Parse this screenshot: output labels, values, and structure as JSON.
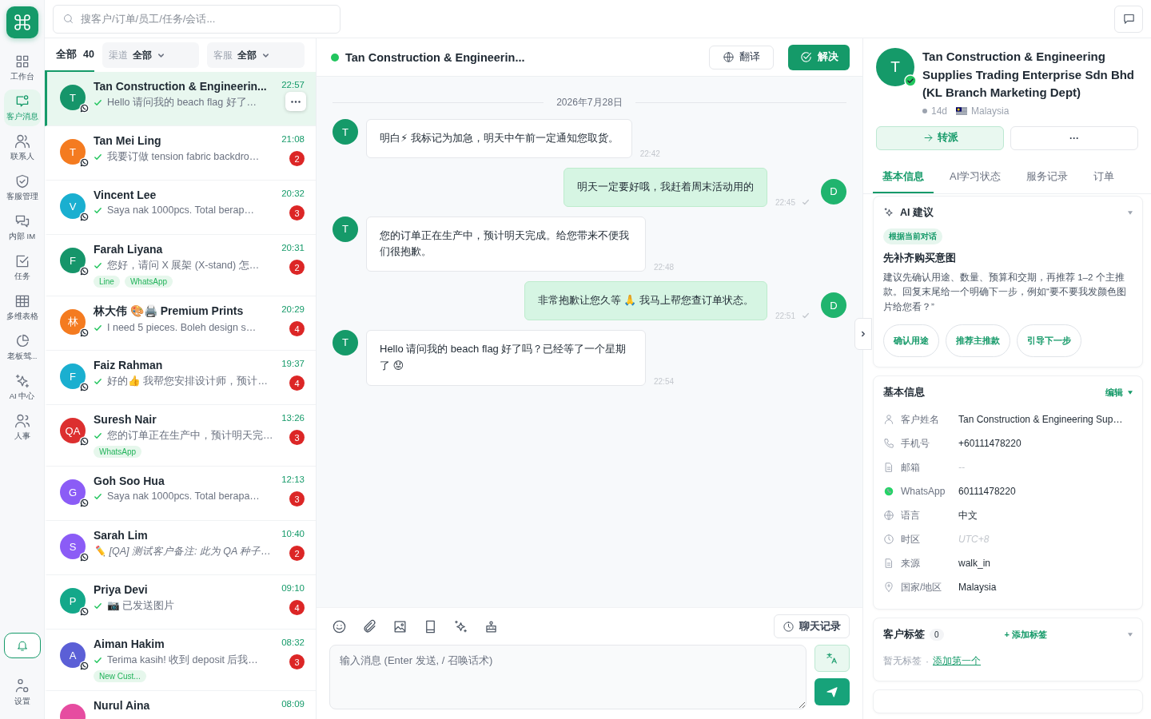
{
  "nav": {
    "items": [
      {
        "label": "工作台",
        "selected": false
      },
      {
        "label": "客户消息",
        "selected": true
      },
      {
        "label": "联系人",
        "selected": false
      },
      {
        "label": "客服管理",
        "selected": false
      },
      {
        "label": "内部 IM",
        "selected": false
      },
      {
        "label": "任务",
        "selected": false
      },
      {
        "label": "多维表格",
        "selected": false
      },
      {
        "label": "老板驾...",
        "selected": false
      },
      {
        "label": "AI 中心",
        "selected": false
      },
      {
        "label": "人事",
        "selected": false
      }
    ],
    "settings_label": "设置"
  },
  "search": {
    "placeholder": "搜客户/订单/员工/任务/会话..."
  },
  "conversation_list": {
    "tab": {
      "label": "全部",
      "count": "40",
      "selected": true
    },
    "filters": [
      {
        "label": "渠道",
        "value": "全部"
      },
      {
        "label": "客服",
        "value": "全部"
      }
    ],
    "items": [
      {
        "name": "Tan Construction & Engineerin...",
        "avatar": "T",
        "color": "#16956a",
        "time": "22:57",
        "kind": "message",
        "preview": "Hello 请问我的 beach flag 好了…",
        "selected": true,
        "hovered": true
      },
      {
        "name": "Tan Mei Ling",
        "avatar": "T",
        "color": "#f47b20",
        "time": "21:08",
        "kind": "message",
        "preview": "我要订做 tension fabric backdro…",
        "unread": "2",
        "selected": false,
        "hovered": false
      },
      {
        "name": "Vincent Lee",
        "avatar": "V",
        "color": "#1aafd0",
        "time": "20:32",
        "kind": "message",
        "preview": "Saya nak 1000pcs. Total berap…",
        "unread": "3",
        "selected": false,
        "hovered": false
      },
      {
        "name": "Farah Liyana",
        "avatar": "F",
        "color": "#16956a",
        "time": "20:31",
        "kind": "message",
        "preview": "您好，请问 X 展架 (X-stand) 怎…",
        "unread": "2",
        "tags": [
          "Line",
          "WhatsApp"
        ],
        "selected": false,
        "hovered": false
      },
      {
        "name": "林大伟 🎨🖨️ Premium Prints",
        "avatar": "林",
        "color": "#f47b20",
        "time": "20:29",
        "kind": "message",
        "preview": "I need 5 pieces. Boleh design s…",
        "unread": "4",
        "selected": false,
        "hovered": false
      },
      {
        "name": "Faiz Rahman",
        "avatar": "F",
        "color": "#1aafd0",
        "time": "19:37",
        "kind": "message",
        "preview": "好的👍 我帮您安排设计师，预计…",
        "unread": "4",
        "selected": false,
        "hovered": false
      },
      {
        "name": "Suresh Nair",
        "avatar": "QA",
        "color": "#dc2f2f",
        "time": "13:26",
        "kind": "message",
        "preview": "您的订单正在生产中，预计明天完…",
        "unread": "3",
        "tags": [
          "WhatsApp"
        ],
        "selected": false,
        "hovered": false
      },
      {
        "name": "Goh Soo Hua",
        "avatar": "G",
        "color": "#8b5cf6",
        "time": "12:13",
        "kind": "message",
        "preview": "Saya nak 1000pcs. Total berapa…",
        "unread": "3",
        "selected": false,
        "hovered": false
      },
      {
        "name": "Sarah Lim",
        "avatar": "S",
        "color": "#8b5cf6",
        "time": "10:40",
        "kind": "note",
        "preview": "✏️ [QA] 测试客户备注: 此为 QA 种子…",
        "unread": "2",
        "selected": false,
        "hovered": false
      },
      {
        "name": "Priya Devi",
        "avatar": "P",
        "color": "#14a88a",
        "time": "09:10",
        "kind": "message",
        "preview": "📷 已发送图片",
        "unread": "4",
        "selected": false,
        "hovered": false
      },
      {
        "name": "Aiman Hakim",
        "avatar": "A",
        "color": "#5b5fd6",
        "time": "08:32",
        "kind": "message",
        "preview": "Terima kasih! 收到 deposit 后我…",
        "unread": "3",
        "tags": [
          "New Cust..."
        ],
        "selected": false,
        "hovered": false
      },
      {
        "name": "Nurul Aina",
        "color": "#e64ca0",
        "time": "08:09",
        "selected": false,
        "hovered": false
      }
    ]
  },
  "chat": {
    "title": "Tan Construction & Engineerin...",
    "online": true,
    "buttons": {
      "translate": "翻译",
      "resolve": "解决"
    },
    "date": "2026年7月28日",
    "messages": [
      {
        "kind": "incoming",
        "avatar": "T",
        "text": "明白⚡ 我标记为加急，明天中午前一定通知您取货。",
        "time": "22:42"
      },
      {
        "kind": "outgoing",
        "avatar": "D",
        "text": "明天一定要好哦，我赶着周末活动用的",
        "time": "22:45",
        "read": true
      },
      {
        "kind": "incoming",
        "avatar": "T",
        "text": "您的订单正在生产中，预计明天完成。给您带来不便我们很抱歉。",
        "time": "22:48"
      },
      {
        "kind": "outgoing",
        "avatar": "D",
        "text": "非常抱歉让您久等 🙏 我马上帮您查订单状态。",
        "time": "22:51",
        "read": true
      },
      {
        "kind": "incoming",
        "avatar": "T",
        "text": "Hello 请问我的 beach flag 好了吗？已经等了一个星期了 😟",
        "time": "22:54"
      }
    ],
    "history_button": "聊天记录",
    "input": {
      "placeholder": "输入消息 (Enter 发送, / 召唤话术)"
    }
  },
  "customer": {
    "avatar": "T",
    "verified": true,
    "name": "Tan Construction & Engineering Supplies Trading Enterprise Sdn Bhd (KL Branch Marketing Dept)",
    "age": "14d",
    "country": "Malaysia",
    "transfer": "转派",
    "more": "···",
    "tabs": [
      {
        "label": "基本信息",
        "selected": true
      },
      {
        "label": "AI学习状态",
        "selected": false
      },
      {
        "label": "服务记录",
        "selected": false
      },
      {
        "label": "订单",
        "selected": false
      }
    ],
    "ai": {
      "title": "AI 建议",
      "chip": "根据当前对话",
      "heading": "先补齐购买意图",
      "body": "建议先确认用途、数量、预算和交期，再推荐 1–2 个主推款。回复末尾给一个明确下一步，例如“要不要我发颜色图片给您看？”",
      "actions": [
        "确认用途",
        "推荐主推款",
        "引导下一步"
      ]
    },
    "info": {
      "title": "基本信息",
      "edit": "编辑",
      "rows": [
        {
          "label": "客户姓名",
          "value": "Tan Construction & Engineering Sup…"
        },
        {
          "label": "手机号",
          "value": "+60111478220"
        },
        {
          "label": "邮箱",
          "value": "--",
          "empty": true
        },
        {
          "label": "WhatsApp",
          "value": "60111478220"
        },
        {
          "label": "语言",
          "value": "中文"
        },
        {
          "label": "时区",
          "value": "UTC+8",
          "empty": true
        },
        {
          "label": "来源",
          "value": "walk_in"
        },
        {
          "label": "国家/地区",
          "value": "Malaysia"
        }
      ]
    },
    "tags": {
      "title": "客户标签",
      "count": "0",
      "add": "+ 添加标签",
      "empty": "暂无标签",
      "separator": "·",
      "link": "添加第一个"
    }
  }
}
